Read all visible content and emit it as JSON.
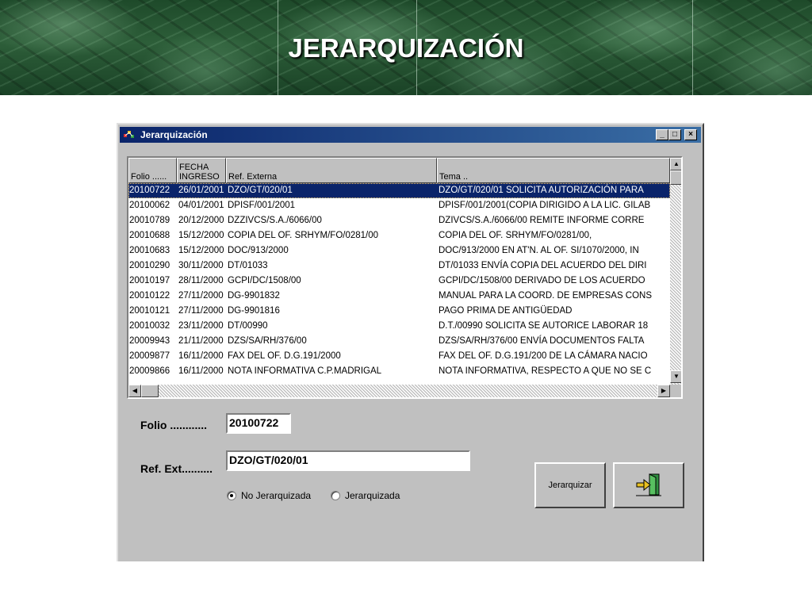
{
  "slide": {
    "title": "JERARQUIZACIÓN"
  },
  "window": {
    "title": "Jerarquización",
    "controls": {
      "minimize": "_",
      "maximize": "□",
      "close": "×"
    }
  },
  "list": {
    "columns": [
      "Folio ......",
      "FECHA\nINGRESO",
      "Ref. Externa",
      "Tema .."
    ],
    "selected_index": 0,
    "rows": [
      [
        "20100722",
        "26/01/2001",
        "DZO/GT/020/01",
        "DZO/GT/020/01 SOLICITA AUTORIZACIÓN PARA"
      ],
      [
        "20100062",
        "04/01/2001",
        "DPISF/001/2001",
        "DPISF/001/2001(COPIA DIRIGIDO A LA LIC. GILAB"
      ],
      [
        "20010789",
        "20/12/2000",
        "DZZIVCS/S.A./6066/00",
        "DZIVCS/S.A./6066/00 REMITE INFORME CORRE"
      ],
      [
        "20010688",
        "15/12/2000",
        "COPIA DEL OF. SRHYM/FO/0281/00",
        "COPIA DEL OF. SRHYM/FO/0281/00,"
      ],
      [
        "20010683",
        "15/12/2000",
        "DOC/913/2000",
        "DOC/913/2000 EN AT'N. AL OF. SI/1070/2000, IN"
      ],
      [
        "20010290",
        "30/11/2000",
        "DT/01033",
        "DT/01033 ENVÍA COPIA DEL ACUERDO DEL DIRI"
      ],
      [
        "20010197",
        "28/11/2000",
        "GCPI/DC/1508/00",
        "GCPI/DC/1508/00 DERIVADO DE LOS ACUERDO"
      ],
      [
        "20010122",
        "27/11/2000",
        "DG-9901832",
        "MANUAL PARA LA COORD. DE EMPRESAS CONS"
      ],
      [
        "20010121",
        "27/11/2000",
        "DG-9901816",
        "PAGO PRIMA DE ANTIGÜEDAD"
      ],
      [
        "20010032",
        "23/11/2000",
        "DT/00990",
        "D.T./00990 SOLICITA SE AUTORICE LABORAR 18"
      ],
      [
        "20009943",
        "21/11/2000",
        "DZS/SA/RH/376/00",
        "DZS/SA/RH/376/00 ENVÍA DOCUMENTOS FALTA"
      ],
      [
        "20009877",
        "16/11/2000",
        "FAX DEL OF. D.G.191/2000",
        "FAX DEL OF. D.G.191/200 DE LA CÁMARA NACIO"
      ],
      [
        "20009866",
        "16/11/2000",
        "NOTA INFORMATIVA C.P.MADRIGAL",
        "NOTA INFORMATIVA, RESPECTO A QUE NO SE C"
      ]
    ]
  },
  "form": {
    "folio_label": "Folio ............",
    "folio_value": "20100722",
    "ref_label": "Ref. Ext..........",
    "ref_value": "DZO/GT/020/01",
    "radio_no_label": "No Jerarquizada",
    "radio_yes_label": "Jerarquizada",
    "radio_selected": "No Jerarquizada"
  },
  "buttons": {
    "jerarquizar_label": "Jerarquizar",
    "exit_icon": "exit-door-icon"
  },
  "colors": {
    "selection": "#0a246a",
    "titlebar": "#0a246a",
    "banner": "#2d5e39"
  }
}
